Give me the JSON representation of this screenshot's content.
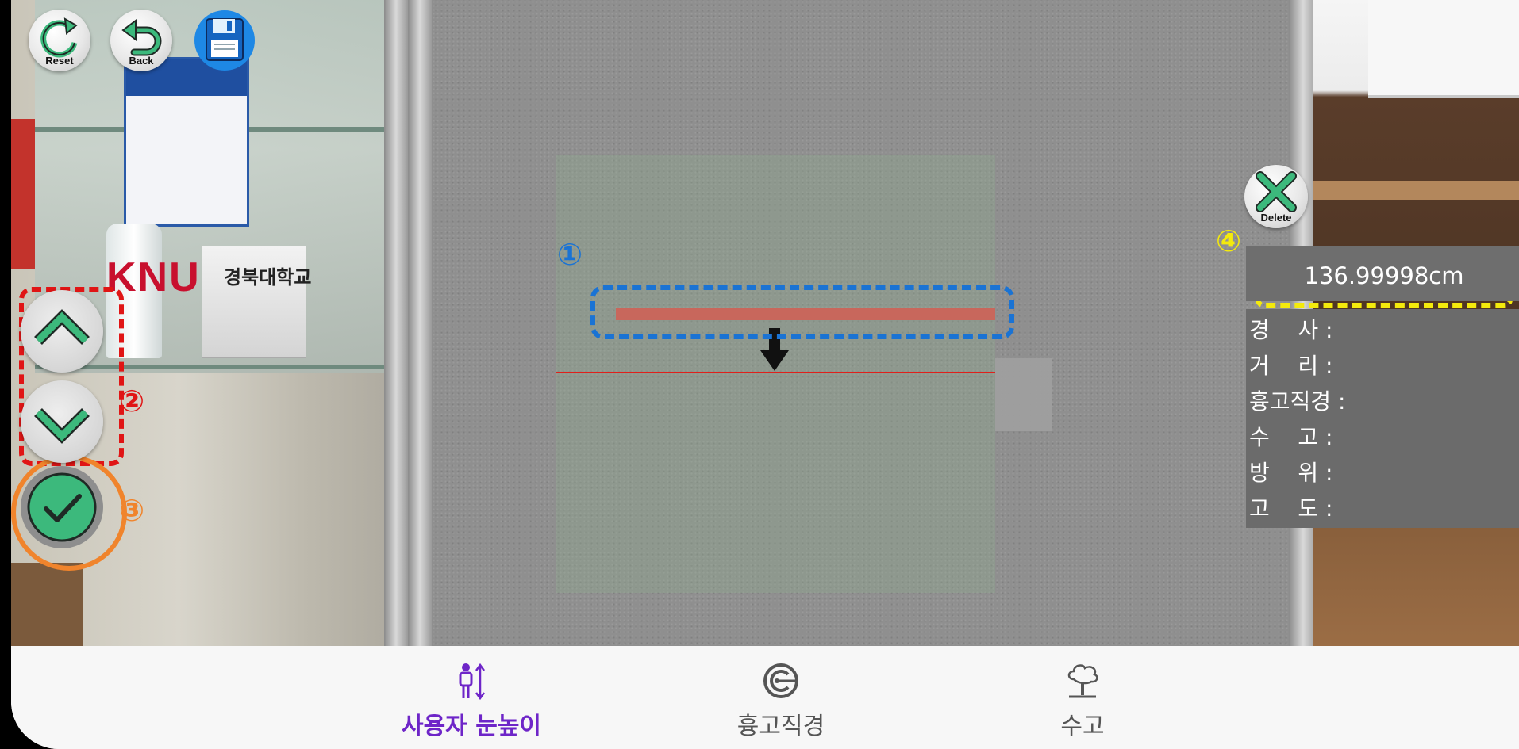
{
  "toolbar": {
    "reset_label": "Reset",
    "back_label": "Back",
    "save_icon": "floppy-disk-icon"
  },
  "camera_scene": {
    "logo_text": "KNU",
    "sign_text": "경북대학교"
  },
  "markers": {
    "m1": "①",
    "m2": "②",
    "m3": "③",
    "m4": "④"
  },
  "controls": {
    "up_icon": "chevron-up-icon",
    "down_icon": "chevron-down-icon",
    "confirm_icon": "check-circle-icon",
    "delete_label": "Delete"
  },
  "measurement": {
    "value": "136.99998cm"
  },
  "info": {
    "rows": [
      {
        "label": "경    사 :"
      },
      {
        "label": "거    리 :"
      },
      {
        "label": "흉고직경 :"
      },
      {
        "label": "수    고 :"
      },
      {
        "label": "방    위 :"
      },
      {
        "label": "고    도 :"
      }
    ]
  },
  "bottom_nav": {
    "items": [
      {
        "label": "사용자 눈높이",
        "icon": "person-height-icon",
        "active": true
      },
      {
        "label": "흉고직경",
        "icon": "trunk-diameter-icon",
        "active": false
      },
      {
        "label": "수고",
        "icon": "tree-icon",
        "active": false
      }
    ]
  },
  "colors": {
    "accent": "#6e25c8",
    "button_green": "#3cb97c",
    "annotation_blue": "#1a73d4",
    "annotation_red": "#e01515",
    "annotation_orange": "#f0842c",
    "annotation_yellow": "#f4ea0c"
  }
}
